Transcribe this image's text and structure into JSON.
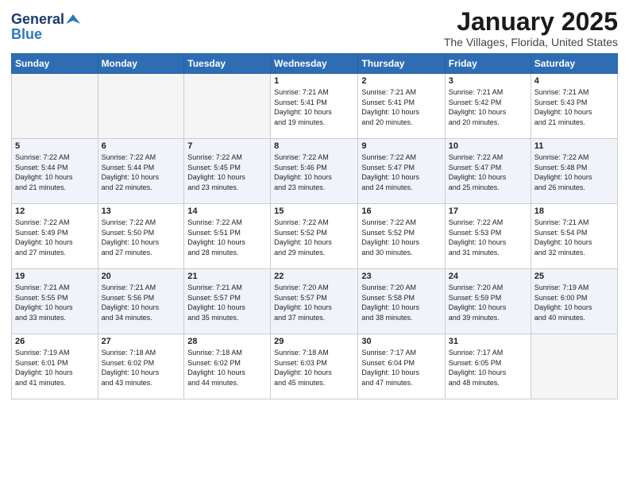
{
  "logo": {
    "line1": "General",
    "line2": "Blue"
  },
  "title": "January 2025",
  "location": "The Villages, Florida, United States",
  "weekdays": [
    "Sunday",
    "Monday",
    "Tuesday",
    "Wednesday",
    "Thursday",
    "Friday",
    "Saturday"
  ],
  "weeks": [
    [
      {
        "day": "",
        "info": ""
      },
      {
        "day": "",
        "info": ""
      },
      {
        "day": "",
        "info": ""
      },
      {
        "day": "1",
        "info": "Sunrise: 7:21 AM\nSunset: 5:41 PM\nDaylight: 10 hours\nand 19 minutes."
      },
      {
        "day": "2",
        "info": "Sunrise: 7:21 AM\nSunset: 5:41 PM\nDaylight: 10 hours\nand 20 minutes."
      },
      {
        "day": "3",
        "info": "Sunrise: 7:21 AM\nSunset: 5:42 PM\nDaylight: 10 hours\nand 20 minutes."
      },
      {
        "day": "4",
        "info": "Sunrise: 7:21 AM\nSunset: 5:43 PM\nDaylight: 10 hours\nand 21 minutes."
      }
    ],
    [
      {
        "day": "5",
        "info": "Sunrise: 7:22 AM\nSunset: 5:44 PM\nDaylight: 10 hours\nand 21 minutes."
      },
      {
        "day": "6",
        "info": "Sunrise: 7:22 AM\nSunset: 5:44 PM\nDaylight: 10 hours\nand 22 minutes."
      },
      {
        "day": "7",
        "info": "Sunrise: 7:22 AM\nSunset: 5:45 PM\nDaylight: 10 hours\nand 23 minutes."
      },
      {
        "day": "8",
        "info": "Sunrise: 7:22 AM\nSunset: 5:46 PM\nDaylight: 10 hours\nand 23 minutes."
      },
      {
        "day": "9",
        "info": "Sunrise: 7:22 AM\nSunset: 5:47 PM\nDaylight: 10 hours\nand 24 minutes."
      },
      {
        "day": "10",
        "info": "Sunrise: 7:22 AM\nSunset: 5:47 PM\nDaylight: 10 hours\nand 25 minutes."
      },
      {
        "day": "11",
        "info": "Sunrise: 7:22 AM\nSunset: 5:48 PM\nDaylight: 10 hours\nand 26 minutes."
      }
    ],
    [
      {
        "day": "12",
        "info": "Sunrise: 7:22 AM\nSunset: 5:49 PM\nDaylight: 10 hours\nand 27 minutes."
      },
      {
        "day": "13",
        "info": "Sunrise: 7:22 AM\nSunset: 5:50 PM\nDaylight: 10 hours\nand 27 minutes."
      },
      {
        "day": "14",
        "info": "Sunrise: 7:22 AM\nSunset: 5:51 PM\nDaylight: 10 hours\nand 28 minutes."
      },
      {
        "day": "15",
        "info": "Sunrise: 7:22 AM\nSunset: 5:52 PM\nDaylight: 10 hours\nand 29 minutes."
      },
      {
        "day": "16",
        "info": "Sunrise: 7:22 AM\nSunset: 5:52 PM\nDaylight: 10 hours\nand 30 minutes."
      },
      {
        "day": "17",
        "info": "Sunrise: 7:22 AM\nSunset: 5:53 PM\nDaylight: 10 hours\nand 31 minutes."
      },
      {
        "day": "18",
        "info": "Sunrise: 7:21 AM\nSunset: 5:54 PM\nDaylight: 10 hours\nand 32 minutes."
      }
    ],
    [
      {
        "day": "19",
        "info": "Sunrise: 7:21 AM\nSunset: 5:55 PM\nDaylight: 10 hours\nand 33 minutes."
      },
      {
        "day": "20",
        "info": "Sunrise: 7:21 AM\nSunset: 5:56 PM\nDaylight: 10 hours\nand 34 minutes."
      },
      {
        "day": "21",
        "info": "Sunrise: 7:21 AM\nSunset: 5:57 PM\nDaylight: 10 hours\nand 35 minutes."
      },
      {
        "day": "22",
        "info": "Sunrise: 7:20 AM\nSunset: 5:57 PM\nDaylight: 10 hours\nand 37 minutes."
      },
      {
        "day": "23",
        "info": "Sunrise: 7:20 AM\nSunset: 5:58 PM\nDaylight: 10 hours\nand 38 minutes."
      },
      {
        "day": "24",
        "info": "Sunrise: 7:20 AM\nSunset: 5:59 PM\nDaylight: 10 hours\nand 39 minutes."
      },
      {
        "day": "25",
        "info": "Sunrise: 7:19 AM\nSunset: 6:00 PM\nDaylight: 10 hours\nand 40 minutes."
      }
    ],
    [
      {
        "day": "26",
        "info": "Sunrise: 7:19 AM\nSunset: 6:01 PM\nDaylight: 10 hours\nand 41 minutes."
      },
      {
        "day": "27",
        "info": "Sunrise: 7:18 AM\nSunset: 6:02 PM\nDaylight: 10 hours\nand 43 minutes."
      },
      {
        "day": "28",
        "info": "Sunrise: 7:18 AM\nSunset: 6:02 PM\nDaylight: 10 hours\nand 44 minutes."
      },
      {
        "day": "29",
        "info": "Sunrise: 7:18 AM\nSunset: 6:03 PM\nDaylight: 10 hours\nand 45 minutes."
      },
      {
        "day": "30",
        "info": "Sunrise: 7:17 AM\nSunset: 6:04 PM\nDaylight: 10 hours\nand 47 minutes."
      },
      {
        "day": "31",
        "info": "Sunrise: 7:17 AM\nSunset: 6:05 PM\nDaylight: 10 hours\nand 48 minutes."
      },
      {
        "day": "",
        "info": ""
      }
    ]
  ]
}
